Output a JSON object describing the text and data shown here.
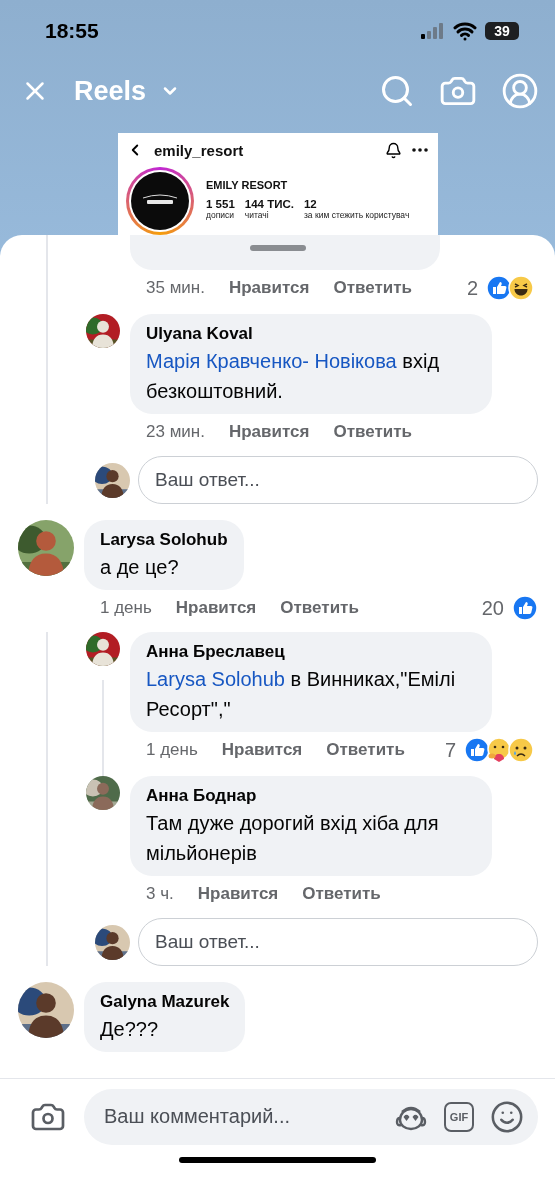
{
  "status_bar": {
    "time": "18:55",
    "battery": "39"
  },
  "header": {
    "title": "Reels"
  },
  "shared_post": {
    "username": "emily_resort",
    "profile_name": "EMILY RESORT",
    "stats": [
      {
        "value": "1 551",
        "label": "дописи"
      },
      {
        "value": "144 ТИС.",
        "label": "читачі"
      },
      {
        "value": "12",
        "label": "за ким стежить користувач"
      }
    ]
  },
  "threads": [
    {
      "replies": [
        {
          "kind": "cut",
          "time": "35 мин.",
          "like": "Нравится",
          "reply": "Ответить",
          "reaction_count": "2",
          "reactions": [
            {
              "kind": "like"
            },
            {
              "kind": "haha"
            }
          ]
        },
        {
          "kind": "full",
          "author": "Ulyana Koval",
          "mention": "Марія Кравченко- Новікова",
          "text": "вхід безкоштовний.",
          "time": "23 мин.",
          "like": "Нравится",
          "reply": "Ответить"
        }
      ],
      "reply_box": {
        "placeholder": "Ваш ответ..."
      }
    },
    {
      "parent": {
        "author": "Larysa Solohub",
        "text": "а де це?",
        "time": "1 день",
        "like": "Нравится",
        "reply": "Ответить",
        "reaction_count": "20",
        "reactions": [
          {
            "kind": "like"
          }
        ]
      },
      "replies": [
        {
          "kind": "full",
          "author": "Анна Бреславец",
          "mention": "Larysa Solohub",
          "text": "в Винниках,\"Емілі Ресорт\",\"",
          "time": "1 день",
          "like": "Нравится",
          "reply": "Ответить",
          "reaction_count": "7",
          "reactions": [
            {
              "kind": "like"
            },
            {
              "kind": "care"
            },
            {
              "kind": "sad"
            }
          ],
          "has_replies": true
        },
        {
          "kind": "full",
          "author": "Анна Боднар",
          "text": "Там дуже дорогий вхід хіба для мільйонерів",
          "time": "3 ч.",
          "like": "Нравится",
          "reply": "Ответить"
        }
      ],
      "reply_box": {
        "placeholder": "Ваш ответ..."
      }
    },
    {
      "parent": {
        "author": "Galyna Mazurek",
        "text": "Де???"
      }
    }
  ],
  "composer": {
    "placeholder": "Ваш комментарий...",
    "gif_label": "GIF"
  }
}
